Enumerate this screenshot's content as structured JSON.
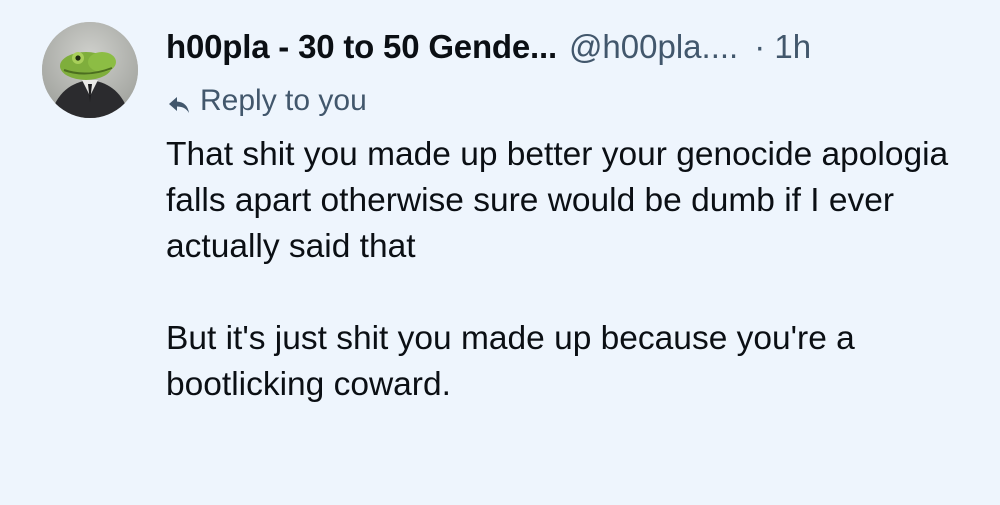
{
  "post": {
    "display_name": "h00pla - 30 to 50 Gende...",
    "handle": "@h00pla....",
    "timestamp": "· 1h",
    "reply_context": "Reply to you",
    "reply_icon": "reply-arrow-icon",
    "avatar_icon": "frog-in-suit-avatar",
    "paragraphs": [
      "That shit you made up better your genocide apologia falls apart otherwise sure would be dumb if I ever actually said that",
      "But it's just shit you made up because you're a bootlicking coward."
    ]
  },
  "colors": {
    "background": "#eef5fd",
    "text": "#0b0f14",
    "secondary_text": "#42576c"
  }
}
